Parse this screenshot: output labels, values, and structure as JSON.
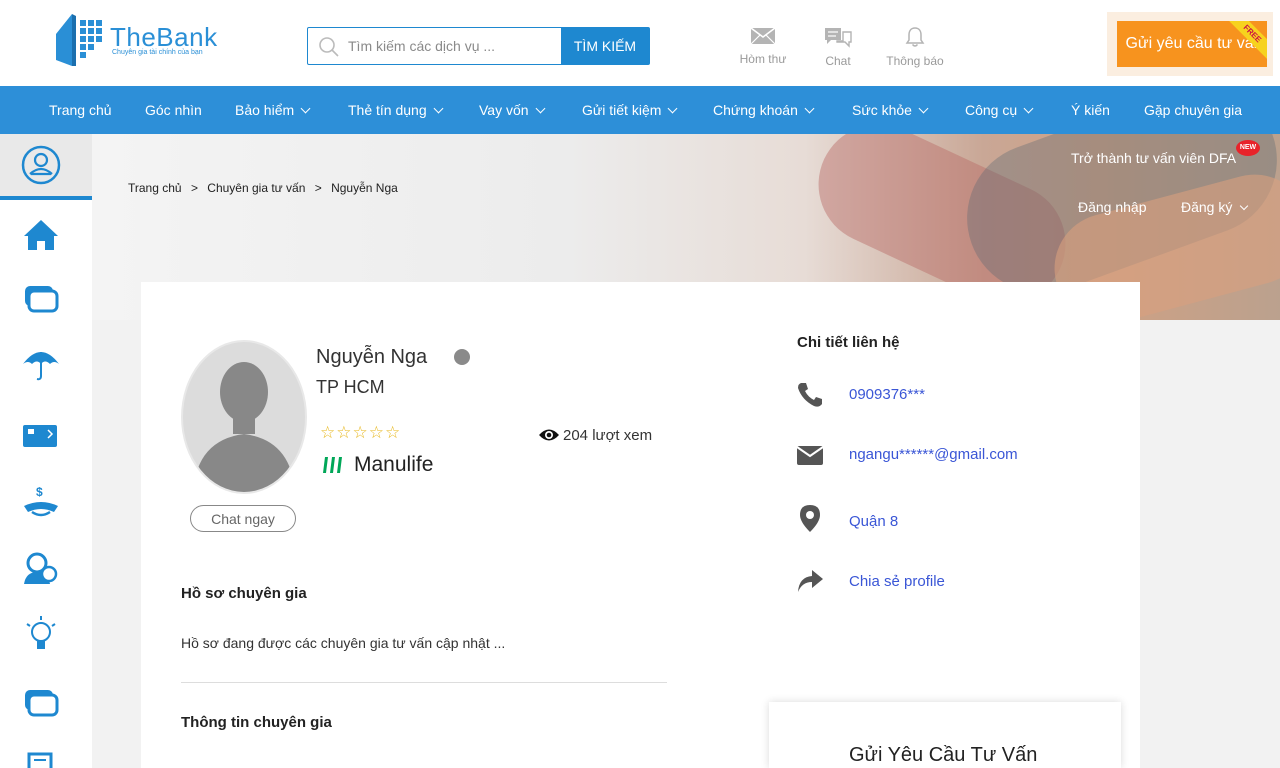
{
  "header": {
    "logo": {
      "brand": "TheBank",
      "tagline": "Chuyên gia tài chính của bạn"
    },
    "search": {
      "placeholder": "Tìm kiếm các dịch vụ ...",
      "button": "TÌM KIẾM"
    },
    "icons": [
      {
        "label": "Hòm thư",
        "icon": "mail-icon"
      },
      {
        "label": "Chat",
        "icon": "chat-icon"
      },
      {
        "label": "Thông báo",
        "icon": "bell-icon"
      }
    ],
    "cta": {
      "label": "Gửi yêu cầu tư vấn",
      "ribbon": "FREE"
    }
  },
  "nav": {
    "items": [
      {
        "label": "Trang chủ",
        "dropdown": false
      },
      {
        "label": "Góc nhìn",
        "dropdown": false
      },
      {
        "label": "Bảo hiểm",
        "dropdown": true
      },
      {
        "label": "Thẻ tín dụng",
        "dropdown": true
      },
      {
        "label": "Vay vốn",
        "dropdown": true
      },
      {
        "label": "Gửi tiết kiệm",
        "dropdown": true
      },
      {
        "label": "Chứng khoán",
        "dropdown": true
      },
      {
        "label": "Sức khỏe",
        "dropdown": true
      },
      {
        "label": "Công cụ",
        "dropdown": true
      },
      {
        "label": "Ý kiến",
        "dropdown": false
      },
      {
        "label": "Gặp chuyên gia",
        "dropdown": false
      }
    ]
  },
  "sidebar": {
    "icons": [
      "user-circle-icon",
      "home-icon",
      "card-stack-icon",
      "umbrella-icon",
      "credit-card-icon",
      "savings-icon",
      "advisor-icon",
      "lightbulb-icon",
      "card-stack-icon-2",
      "document-icon"
    ]
  },
  "banner": {
    "breadcrumb": [
      "Trang chủ",
      ">",
      "Chuyên gia tư vấn",
      ">",
      "Nguyễn Nga"
    ],
    "become_advisor": "Trở thành tư vấn viên DFA",
    "new_badge": "NEW",
    "login": "Đăng nhập",
    "register": "Đăng ký"
  },
  "profile": {
    "name": "Nguyễn Nga",
    "city": "TP HCM",
    "stars": "☆☆☆☆☆",
    "company": "Manulife",
    "views": "204 lượt xem",
    "chat_button": "Chat ngay",
    "profile_title": "Hồ sơ chuyên gia",
    "profile_text": "Hồ sơ đang được các chuyên gia tư vấn cập nhật ...",
    "info_title": "Thông tin chuyên gia"
  },
  "contact": {
    "title": "Chi tiết liên hệ",
    "phone": "0909376***",
    "email": "ngangu******@gmail.com",
    "location": "Quận 8",
    "share": "Chia sẻ profile"
  },
  "request": {
    "title": "Gửi Yêu Cầu Tư Vấn"
  },
  "colors": {
    "primary": "#2d8fd8",
    "cta": "#f7931e",
    "link": "#3a56d6",
    "manulife": "#00a758"
  }
}
